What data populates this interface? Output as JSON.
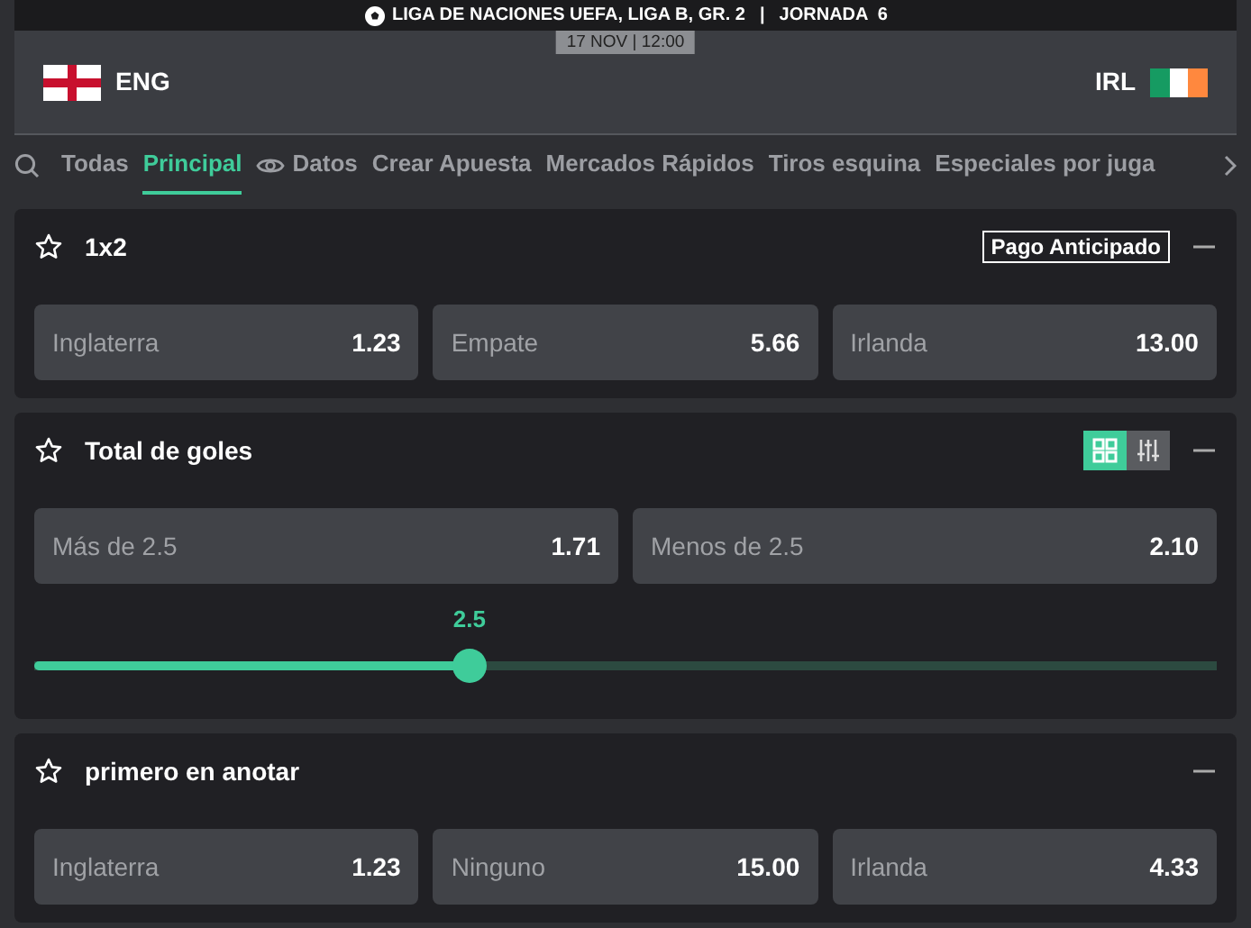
{
  "match": {
    "competition": "LIGA DE NACIONES UEFA, LIGA B, GR. 2",
    "separator": "|",
    "round": "JORNADA  6",
    "datetime": "17 NOV | 12:00",
    "home": "ENG",
    "away": "IRL"
  },
  "tabs": [
    {
      "label": "Todas",
      "kind": "plain",
      "selected": false
    },
    {
      "label": "Principal",
      "kind": "plain",
      "selected": true
    },
    {
      "label": "Datos",
      "kind": "eye",
      "selected": false
    },
    {
      "label": "Crear Apuesta",
      "kind": "plain",
      "selected": false
    },
    {
      "label": "Mercados Rápidos",
      "kind": "plain",
      "selected": false
    },
    {
      "label": "Tiros esquina",
      "kind": "plain",
      "selected": false
    },
    {
      "label": "Especiales por juga",
      "kind": "plain",
      "selected": false
    }
  ],
  "markets": [
    {
      "title": "1x2",
      "badge": "Pago Anticipado",
      "outcomes": [
        {
          "label": "Inglaterra",
          "odds": "1.23"
        },
        {
          "label": "Empate",
          "odds": "5.66"
        },
        {
          "label": "Irlanda",
          "odds": "13.00"
        }
      ]
    },
    {
      "title": "Total de goles",
      "view_toggle": [
        {
          "selected": true
        },
        {
          "selected": false
        }
      ],
      "outcomes": [
        {
          "label": "Más de 2.5",
          "odds": "1.71"
        },
        {
          "label": "Menos de 2.5",
          "odds": "2.10"
        }
      ],
      "slider": {
        "value": "2.5",
        "level": 0.368
      }
    },
    {
      "title": "primero en anotar",
      "outcomes": [
        {
          "label": "Inglaterra",
          "odds": "1.23"
        },
        {
          "label": "Ninguno",
          "odds": "15.00"
        },
        {
          "label": "Irlanda",
          "odds": "4.33"
        }
      ]
    }
  ]
}
